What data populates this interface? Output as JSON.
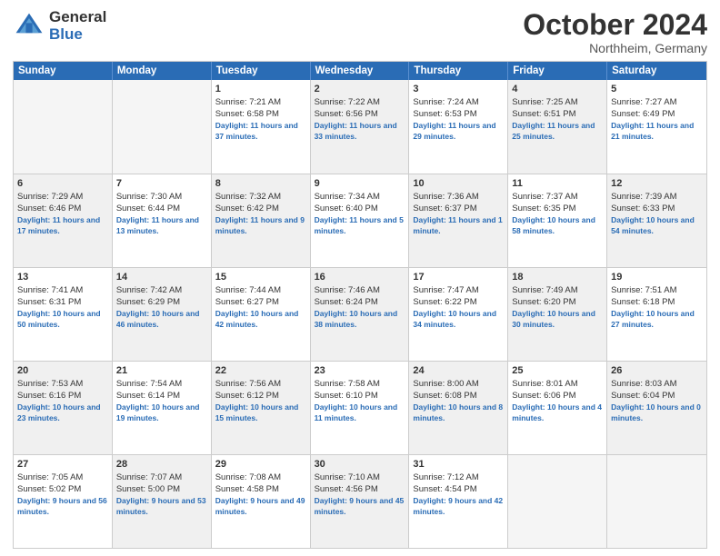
{
  "header": {
    "logo_general": "General",
    "logo_blue": "Blue",
    "month_title": "October 2024",
    "location": "Northheim, Germany"
  },
  "days_of_week": [
    "Sunday",
    "Monday",
    "Tuesday",
    "Wednesday",
    "Thursday",
    "Friday",
    "Saturday"
  ],
  "weeks": [
    [
      {
        "day": "",
        "sunrise": "",
        "sunset": "",
        "daylight": "",
        "bg": "empty"
      },
      {
        "day": "",
        "sunrise": "",
        "sunset": "",
        "daylight": "",
        "bg": "empty"
      },
      {
        "day": "1",
        "sunrise": "Sunrise: 7:21 AM",
        "sunset": "Sunset: 6:58 PM",
        "daylight": "Daylight: 11 hours and 37 minutes.",
        "bg": ""
      },
      {
        "day": "2",
        "sunrise": "Sunrise: 7:22 AM",
        "sunset": "Sunset: 6:56 PM",
        "daylight": "Daylight: 11 hours and 33 minutes.",
        "bg": "alt"
      },
      {
        "day": "3",
        "sunrise": "Sunrise: 7:24 AM",
        "sunset": "Sunset: 6:53 PM",
        "daylight": "Daylight: 11 hours and 29 minutes.",
        "bg": ""
      },
      {
        "day": "4",
        "sunrise": "Sunrise: 7:25 AM",
        "sunset": "Sunset: 6:51 PM",
        "daylight": "Daylight: 11 hours and 25 minutes.",
        "bg": "alt"
      },
      {
        "day": "5",
        "sunrise": "Sunrise: 7:27 AM",
        "sunset": "Sunset: 6:49 PM",
        "daylight": "Daylight: 11 hours and 21 minutes.",
        "bg": ""
      }
    ],
    [
      {
        "day": "6",
        "sunrise": "Sunrise: 7:29 AM",
        "sunset": "Sunset: 6:46 PM",
        "daylight": "Daylight: 11 hours and 17 minutes.",
        "bg": "alt"
      },
      {
        "day": "7",
        "sunrise": "Sunrise: 7:30 AM",
        "sunset": "Sunset: 6:44 PM",
        "daylight": "Daylight: 11 hours and 13 minutes.",
        "bg": ""
      },
      {
        "day": "8",
        "sunrise": "Sunrise: 7:32 AM",
        "sunset": "Sunset: 6:42 PM",
        "daylight": "Daylight: 11 hours and 9 minutes.",
        "bg": "alt"
      },
      {
        "day": "9",
        "sunrise": "Sunrise: 7:34 AM",
        "sunset": "Sunset: 6:40 PM",
        "daylight": "Daylight: 11 hours and 5 minutes.",
        "bg": ""
      },
      {
        "day": "10",
        "sunrise": "Sunrise: 7:36 AM",
        "sunset": "Sunset: 6:37 PM",
        "daylight": "Daylight: 11 hours and 1 minute.",
        "bg": "alt"
      },
      {
        "day": "11",
        "sunrise": "Sunrise: 7:37 AM",
        "sunset": "Sunset: 6:35 PM",
        "daylight": "Daylight: 10 hours and 58 minutes.",
        "bg": ""
      },
      {
        "day": "12",
        "sunrise": "Sunrise: 7:39 AM",
        "sunset": "Sunset: 6:33 PM",
        "daylight": "Daylight: 10 hours and 54 minutes.",
        "bg": "alt"
      }
    ],
    [
      {
        "day": "13",
        "sunrise": "Sunrise: 7:41 AM",
        "sunset": "Sunset: 6:31 PM",
        "daylight": "Daylight: 10 hours and 50 minutes.",
        "bg": ""
      },
      {
        "day": "14",
        "sunrise": "Sunrise: 7:42 AM",
        "sunset": "Sunset: 6:29 PM",
        "daylight": "Daylight: 10 hours and 46 minutes.",
        "bg": "alt"
      },
      {
        "day": "15",
        "sunrise": "Sunrise: 7:44 AM",
        "sunset": "Sunset: 6:27 PM",
        "daylight": "Daylight: 10 hours and 42 minutes.",
        "bg": ""
      },
      {
        "day": "16",
        "sunrise": "Sunrise: 7:46 AM",
        "sunset": "Sunset: 6:24 PM",
        "daylight": "Daylight: 10 hours and 38 minutes.",
        "bg": "alt"
      },
      {
        "day": "17",
        "sunrise": "Sunrise: 7:47 AM",
        "sunset": "Sunset: 6:22 PM",
        "daylight": "Daylight: 10 hours and 34 minutes.",
        "bg": ""
      },
      {
        "day": "18",
        "sunrise": "Sunrise: 7:49 AM",
        "sunset": "Sunset: 6:20 PM",
        "daylight": "Daylight: 10 hours and 30 minutes.",
        "bg": "alt"
      },
      {
        "day": "19",
        "sunrise": "Sunrise: 7:51 AM",
        "sunset": "Sunset: 6:18 PM",
        "daylight": "Daylight: 10 hours and 27 minutes.",
        "bg": ""
      }
    ],
    [
      {
        "day": "20",
        "sunrise": "Sunrise: 7:53 AM",
        "sunset": "Sunset: 6:16 PM",
        "daylight": "Daylight: 10 hours and 23 minutes.",
        "bg": "alt"
      },
      {
        "day": "21",
        "sunrise": "Sunrise: 7:54 AM",
        "sunset": "Sunset: 6:14 PM",
        "daylight": "Daylight: 10 hours and 19 minutes.",
        "bg": ""
      },
      {
        "day": "22",
        "sunrise": "Sunrise: 7:56 AM",
        "sunset": "Sunset: 6:12 PM",
        "daylight": "Daylight: 10 hours and 15 minutes.",
        "bg": "alt"
      },
      {
        "day": "23",
        "sunrise": "Sunrise: 7:58 AM",
        "sunset": "Sunset: 6:10 PM",
        "daylight": "Daylight: 10 hours and 11 minutes.",
        "bg": ""
      },
      {
        "day": "24",
        "sunrise": "Sunrise: 8:00 AM",
        "sunset": "Sunset: 6:08 PM",
        "daylight": "Daylight: 10 hours and 8 minutes.",
        "bg": "alt"
      },
      {
        "day": "25",
        "sunrise": "Sunrise: 8:01 AM",
        "sunset": "Sunset: 6:06 PM",
        "daylight": "Daylight: 10 hours and 4 minutes.",
        "bg": ""
      },
      {
        "day": "26",
        "sunrise": "Sunrise: 8:03 AM",
        "sunset": "Sunset: 6:04 PM",
        "daylight": "Daylight: 10 hours and 0 minutes.",
        "bg": "alt"
      }
    ],
    [
      {
        "day": "27",
        "sunrise": "Sunrise: 7:05 AM",
        "sunset": "Sunset: 5:02 PM",
        "daylight": "Daylight: 9 hours and 56 minutes.",
        "bg": ""
      },
      {
        "day": "28",
        "sunrise": "Sunrise: 7:07 AM",
        "sunset": "Sunset: 5:00 PM",
        "daylight": "Daylight: 9 hours and 53 minutes.",
        "bg": "alt"
      },
      {
        "day": "29",
        "sunrise": "Sunrise: 7:08 AM",
        "sunset": "Sunset: 4:58 PM",
        "daylight": "Daylight: 9 hours and 49 minutes.",
        "bg": ""
      },
      {
        "day": "30",
        "sunrise": "Sunrise: 7:10 AM",
        "sunset": "Sunset: 4:56 PM",
        "daylight": "Daylight: 9 hours and 45 minutes.",
        "bg": "alt"
      },
      {
        "day": "31",
        "sunrise": "Sunrise: 7:12 AM",
        "sunset": "Sunset: 4:54 PM",
        "daylight": "Daylight: 9 hours and 42 minutes.",
        "bg": ""
      },
      {
        "day": "",
        "sunrise": "",
        "sunset": "",
        "daylight": "",
        "bg": "empty"
      },
      {
        "day": "",
        "sunrise": "",
        "sunset": "",
        "daylight": "",
        "bg": "empty"
      }
    ]
  ]
}
